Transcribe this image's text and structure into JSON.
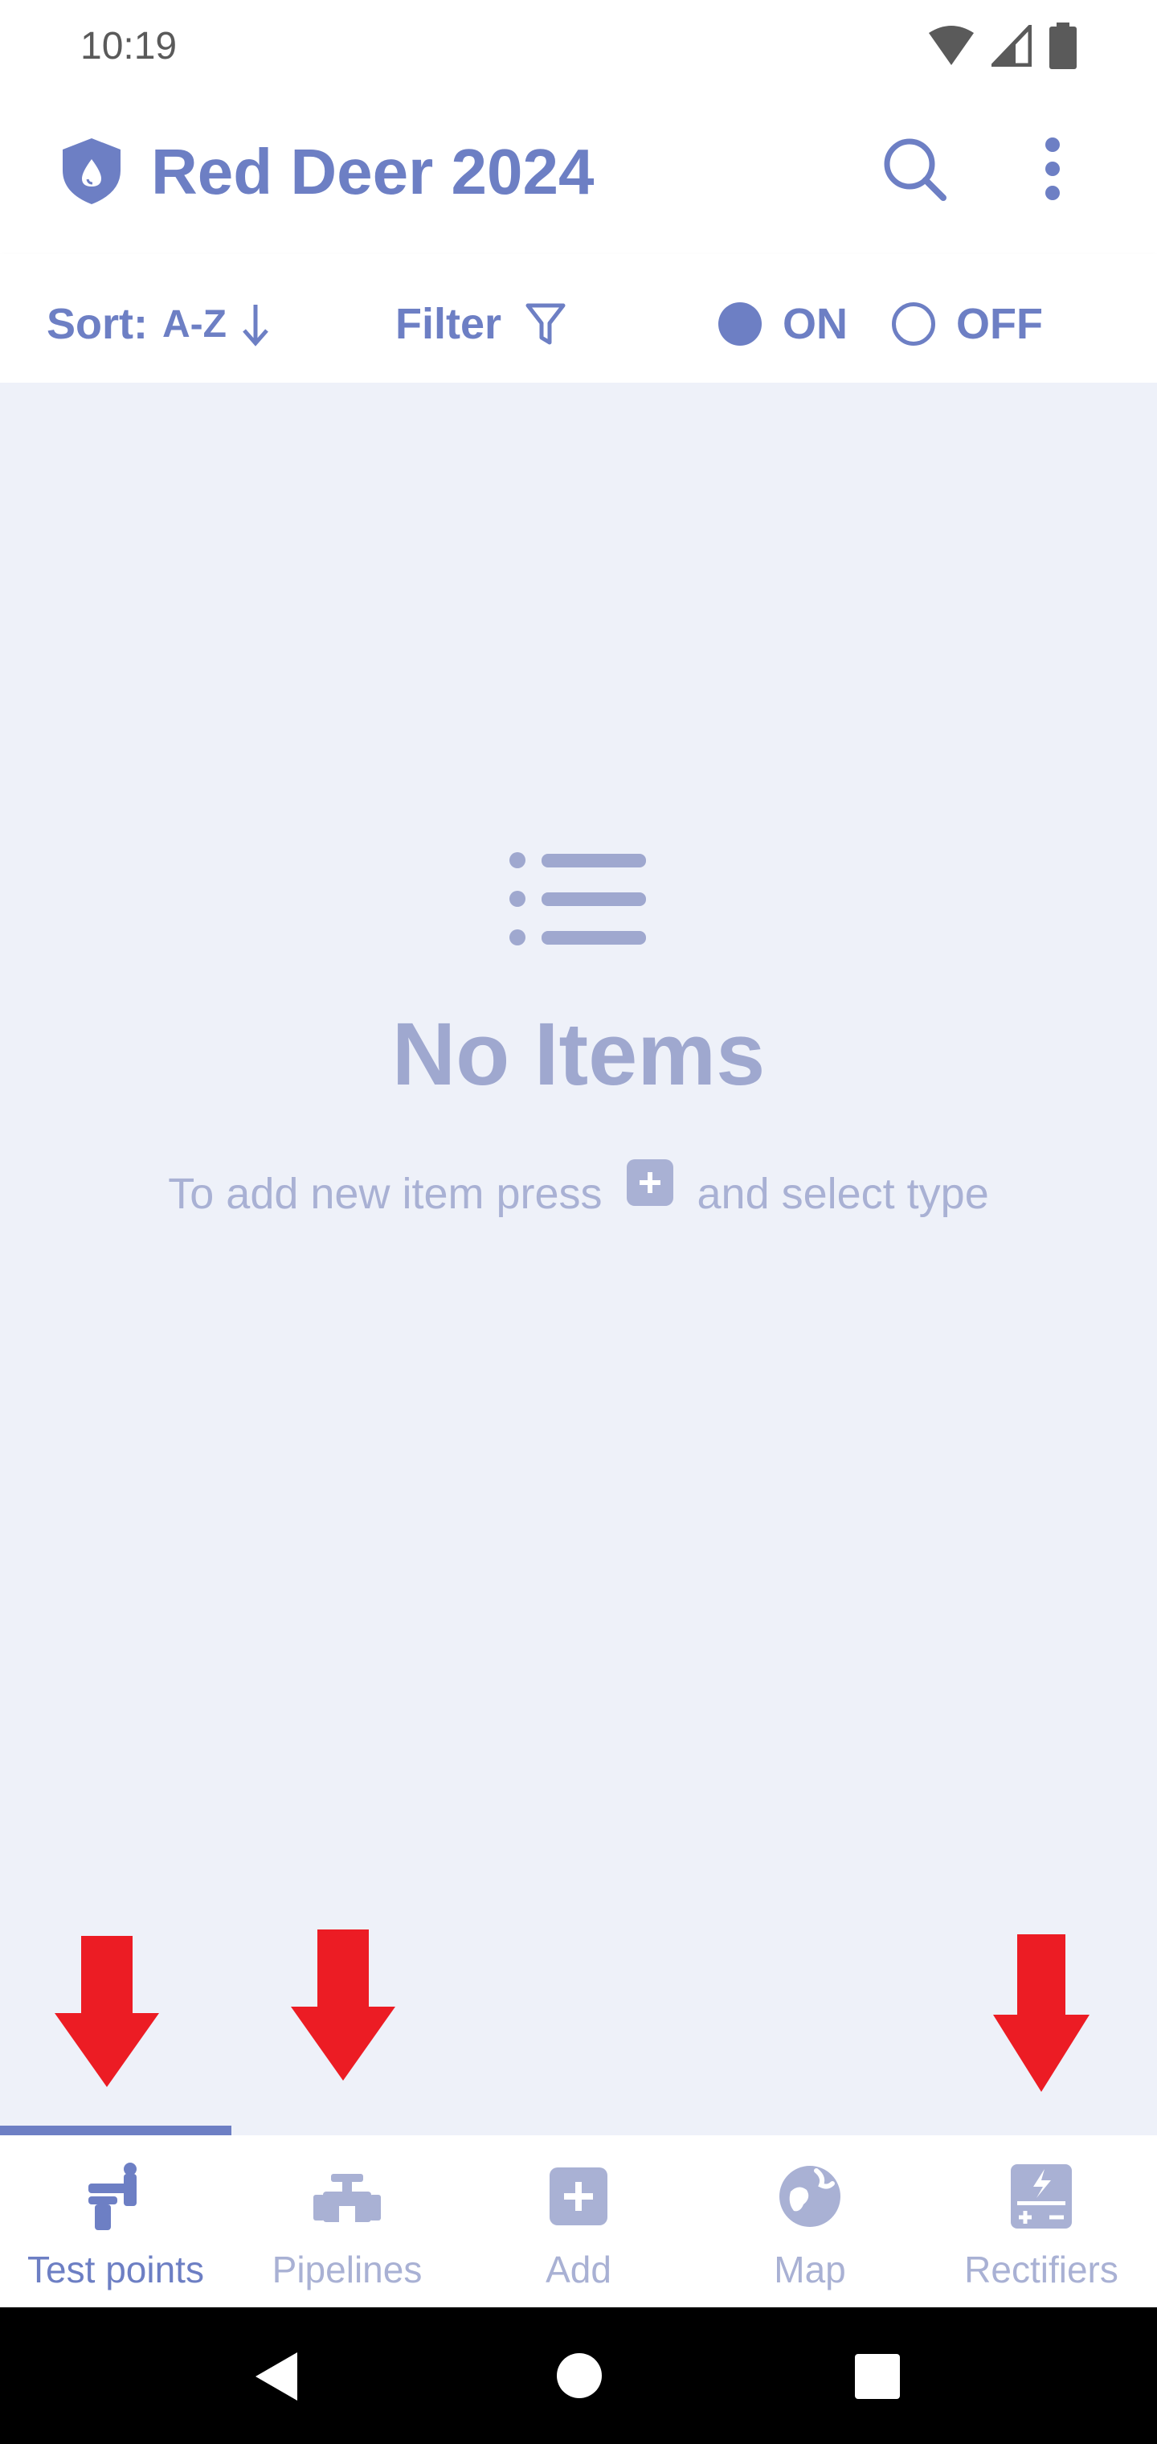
{
  "status_bar": {
    "time": "10:19"
  },
  "app_bar": {
    "title": "Red Deer 2024"
  },
  "toolbar": {
    "sort_label": "Sort:",
    "sort_value": "A-Z",
    "filter_label": "Filter",
    "on_label": "ON",
    "off_label": "OFF",
    "selected": "ON"
  },
  "empty_state": {
    "title": "No Items",
    "hint_before": "To add new item press",
    "hint_after": "and select type"
  },
  "bottom_nav": {
    "items": [
      {
        "label": "Test points",
        "icon": "test-point-icon",
        "active": true
      },
      {
        "label": "Pipelines",
        "icon": "pipeline-icon",
        "active": false
      },
      {
        "label": "Add",
        "icon": "add-square-icon",
        "active": false
      },
      {
        "label": "Map",
        "icon": "globe-icon",
        "active": false
      },
      {
        "label": "Rectifiers",
        "icon": "rectifier-icon",
        "active": false
      }
    ]
  },
  "colors": {
    "accent": "#6d7fc4",
    "inactive": "#a9b1d4",
    "background": "#eef1f9",
    "annotation_arrow": "#ec1c24"
  }
}
